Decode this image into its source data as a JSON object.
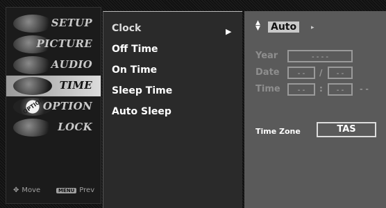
{
  "categories": [
    {
      "label": "SETUP"
    },
    {
      "label": "PICTURE"
    },
    {
      "label": "AUDIO"
    },
    {
      "label": "TIME",
      "active": true
    },
    {
      "label": "OPTION"
    },
    {
      "label": "LOCK"
    }
  ],
  "footer": {
    "move_label": "Move",
    "menu_key": "MENU",
    "prev_label": "Prev"
  },
  "time_menu": {
    "items": [
      {
        "label": "Clock",
        "selected": true
      },
      {
        "label": "Off Time"
      },
      {
        "label": "On Time"
      },
      {
        "label": "Sleep Time"
      },
      {
        "label": "Auto Sleep"
      }
    ],
    "arrow": "▶"
  },
  "clock": {
    "mode": "Auto",
    "year_label": "Year",
    "date_label": "Date",
    "time_label": "Time",
    "year_value": "- - - -",
    "date_month": "- -",
    "date_day": "- -",
    "time_hour": "- -",
    "time_min": "- -",
    "time_ampm": "- -",
    "date_sep": "/",
    "time_sep": ":",
    "tz_label": "Time Zone",
    "tz_value": "TAS"
  },
  "colors": {
    "highlight": "#dcdcdc",
    "panel_right": "#5a5a5a"
  }
}
